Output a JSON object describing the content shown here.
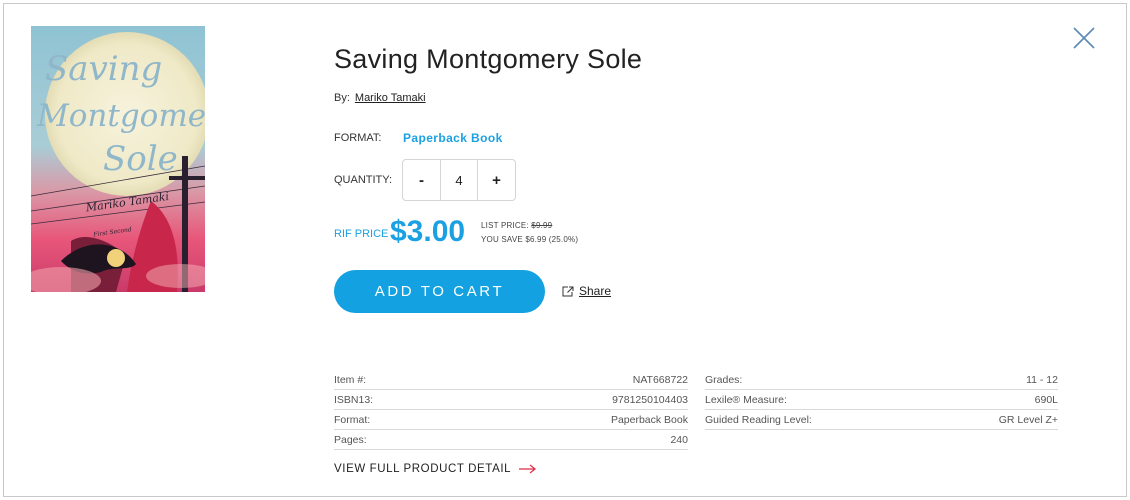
{
  "product": {
    "title": "Saving Montgomery Sole",
    "by_label": "By:",
    "author": "Mariko Tamaki",
    "format_label": "FORMAT:",
    "format_value": "Paperback Book",
    "quantity_label": "QUANTITY:",
    "quantity": "4",
    "decrement_label": "-",
    "increment_label": "+",
    "rif_price_label": "RIF PRICE",
    "rif_price": "$3.00",
    "list_price_label": "LIST PRICE:",
    "list_price": "$9.99",
    "you_save": "YOU SAVE $6.99 (25.0%)",
    "add_to_cart_label": "ADD TO CART",
    "share_label": "Share"
  },
  "cover": {
    "title_line1": "Saving",
    "title_line2": "Montgomery",
    "title_line3": "Sole",
    "author_text": "Mariko Tamaki",
    "tagline": "First Second"
  },
  "details": {
    "left": [
      {
        "key": "Item #:",
        "value": "NAT668722"
      },
      {
        "key": "ISBN13:",
        "value": "9781250104403"
      },
      {
        "key": "Format:",
        "value": "Paperback Book"
      },
      {
        "key": "Pages:",
        "value": "240"
      }
    ],
    "right": [
      {
        "key": "Grades:",
        "value": "11 - 12"
      },
      {
        "key": "Lexile® Measure:",
        "value": "690L"
      },
      {
        "key": "Guided Reading Level:",
        "value": "GR Level Z+"
      }
    ]
  },
  "view_full_label": "VIEW FULL PRODUCT DETAIL",
  "colors": {
    "accent": "#13a1e1",
    "arrow": "#e0334c",
    "close": "#5a8ab5"
  },
  "icons": {
    "close": "close-icon",
    "share": "external-link-icon",
    "arrow": "arrow-right-icon"
  }
}
